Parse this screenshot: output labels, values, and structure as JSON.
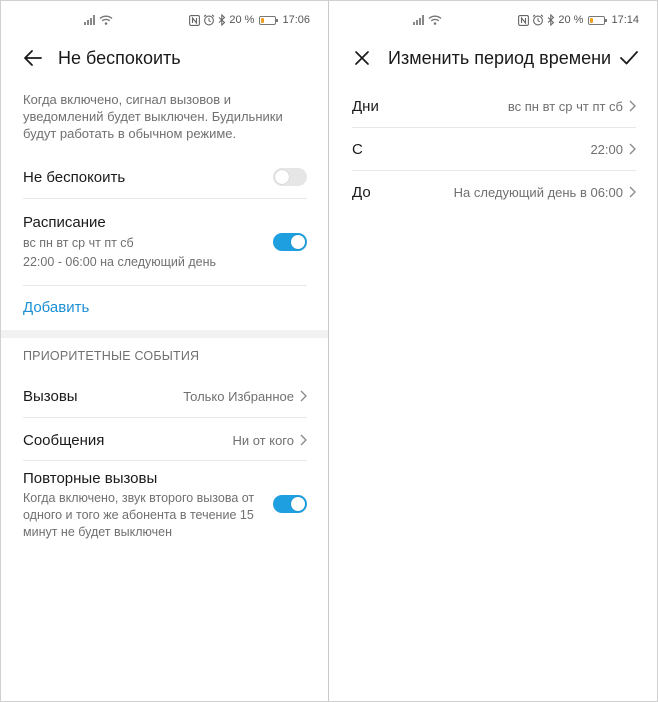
{
  "left": {
    "status": {
      "battery": "20 %",
      "time": "17:06",
      "battery_level": 0.2
    },
    "title": "Не беспокоить",
    "description": "Когда включено, сигнал вызовов и уведомлений будет выключен. Будильники будут работать в обычном режиме.",
    "dnd": {
      "label": "Не беспокоить",
      "enabled": false
    },
    "schedule": {
      "label": "Расписание",
      "days": "вс пн вт ср чт пт сб",
      "time": "22:00 - 06:00 на следующий день",
      "enabled": true
    },
    "add_label": "Добавить",
    "priority_header": "ПРИОРИТЕТНЫЕ СОБЫТИЯ",
    "calls": {
      "label": "Вызовы",
      "value": "Только Избранное"
    },
    "messages": {
      "label": "Сообщения",
      "value": "Ни от кого"
    },
    "repeat": {
      "label": "Повторные вызовы",
      "description": "Когда включено, звук второго вызова от одного и того же абонента в течение 15 минут не будет выключен",
      "enabled": true
    }
  },
  "right": {
    "status": {
      "battery": "20 %",
      "time": "17:14",
      "battery_level": 0.2
    },
    "title": "Изменить период времени",
    "days": {
      "label": "Дни",
      "value": "вс пн вт ср чт пт сб"
    },
    "from": {
      "label": "С",
      "value": "22:00"
    },
    "to": {
      "label": "До",
      "value": "На следующий день в 06:00"
    }
  },
  "icons": {
    "back": "arrow-left-icon",
    "close": "close-icon",
    "confirm": "checkmark-icon",
    "chevron": "chevron-right-icon",
    "signal": "signal-icon",
    "wifi": "wifi-icon",
    "nfc": "nfc-icon",
    "alarm": "alarm-icon",
    "bluetooth": "bluetooth-icon",
    "battery": "battery-icon"
  },
  "colors": {
    "accent": "#1d8fd6",
    "toggle_on": "#1ea0e0",
    "toggle_off": "#e6e6e6",
    "secondary_text": "#707070"
  }
}
